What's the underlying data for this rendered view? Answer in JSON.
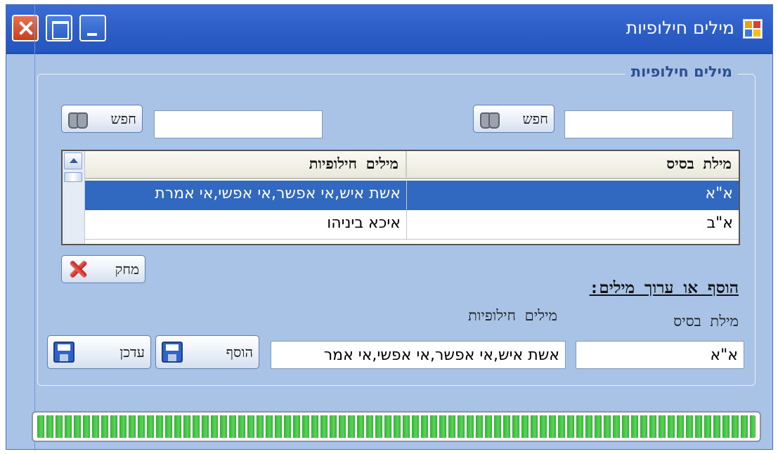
{
  "window": {
    "title": "מילים חילופיות"
  },
  "group": {
    "legend": "מילים חילופיות"
  },
  "search": {
    "base_value": "",
    "alt_value": "",
    "base_button_label": "חפש",
    "alt_button_label": "חפש"
  },
  "grid": {
    "headers": {
      "base": "מילת בסיס",
      "alt": "מילים חילופיות"
    },
    "rows": [
      {
        "base": "א\"א",
        "alt": "אשת איש,אי אפשר,אי אפשי,אי אמרת",
        "selected": true
      },
      {
        "base": "א\"ב",
        "alt": "איכא ביניהו",
        "selected": false
      }
    ]
  },
  "delete_button_label": "מחק",
  "edit_section": {
    "title": "הוסף או ערוך מילים:",
    "base_label": "מילת בסיס",
    "alt_label": "מילים חילופיות",
    "base_value": "א\"א",
    "alt_value": "אשת איש,אי אפשר,אי אפשי,אי אמר",
    "add_button_label": "הוסף",
    "update_button_label": "עדכן"
  },
  "progress": {
    "fraction": 1.0,
    "color": "#2fb52f"
  },
  "icons": {
    "close": "close-icon",
    "maximize": "maximize-icon",
    "minimize": "minimize-icon",
    "app": "app-icon",
    "search": "binoculars-icon",
    "delete": "delete-icon",
    "save": "floppy-disk-icon"
  }
}
